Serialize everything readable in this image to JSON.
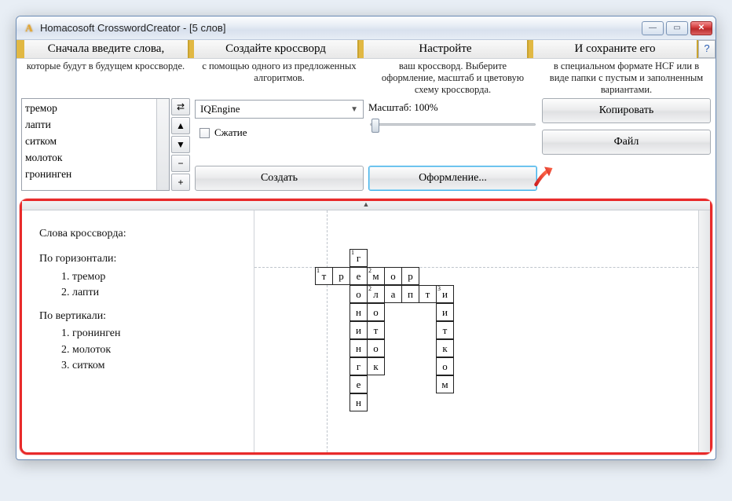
{
  "title": "Homacosoft CrosswordCreator - [5 слов]",
  "app_icon_glyph": "A",
  "steps": {
    "s1": {
      "header": "Сначала введите слова,",
      "desc": "которые будут в будущем кроссворде."
    },
    "s2": {
      "header": "Создайте кроссворд",
      "desc": "с помощью одного из предложенных алгоритмов."
    },
    "s3": {
      "header": "Настройте",
      "desc": "ваш кроссворд. Выберите оформление, масштаб и цветовую схему кроссворда."
    },
    "s4": {
      "header": "И сохраните его",
      "desc": "в специальном формате HCF или в виде папки с пустым и заполненным вариантами."
    }
  },
  "help_label": "?",
  "words": {
    "w1": "тремор",
    "w2": "лапти",
    "w3": "ситком",
    "w4": "молоток",
    "w5": "гронинген"
  },
  "tools": {
    "swap": "⇄",
    "up": "▲",
    "down": "▼",
    "minus": "−",
    "plus": "+"
  },
  "engine": {
    "selected": "IQEngine"
  },
  "compress_label": "Сжатие",
  "create_btn": "Создать",
  "zoom_label": "Масштаб: 100%",
  "design_btn": "Оформление...",
  "copy_btn": "Копировать",
  "file_btn": "Файл",
  "clues": {
    "title": "Слова кроссворда:",
    "across_title": "По горизонтали:",
    "down_title": "По вертикали:",
    "across1": "1. тремор",
    "across2": "2. лапти",
    "down1": "1. гронинген",
    "down2": "2. молоток",
    "down3": "3. ситком"
  },
  "grid": {
    "r0": {
      "c2": "г",
      "n2": "1"
    },
    "r1": {
      "c0": "т",
      "n0": "1",
      "c1": "р",
      "c2": "е",
      "c3": "м",
      "n3": "2",
      "c4": "о",
      "c5": "р"
    },
    "r2": {
      "c2": "о",
      "c3": "л",
      "n3": "2",
      "c4": "а",
      "c5": "п",
      "c6": "т",
      "c7": "и",
      "n7": "3"
    },
    "r3": {
      "c2": "н",
      "c3": "о",
      "c7": "и"
    },
    "r4": {
      "c2": "и",
      "c3": "т",
      "c7": "т"
    },
    "r5": {
      "c2": "н",
      "c3": "о",
      "c7": "к"
    },
    "r6": {
      "c2": "г",
      "c3": "к",
      "c7": "о"
    },
    "r7": {
      "c2": "е",
      "c7": "м"
    },
    "r8": {
      "c2": "н"
    }
  }
}
